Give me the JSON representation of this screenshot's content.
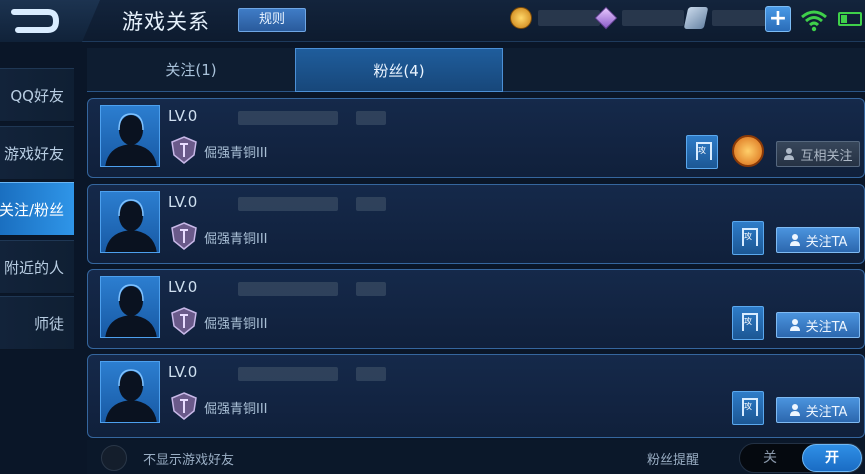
{
  "header": {
    "title": "游戏关系",
    "rules_label": "规则",
    "plus_label": "+"
  },
  "sidebar": {
    "items": [
      {
        "label": "QQ好友"
      },
      {
        "label": "游戏好友"
      },
      {
        "label": "关注/粉丝"
      },
      {
        "label": "附近的人"
      },
      {
        "label": "师徒"
      }
    ]
  },
  "tabs": [
    {
      "label": "关注(1)"
    },
    {
      "label": "粉丝(4)"
    }
  ],
  "rows": [
    {
      "level": "LV.0",
      "rank": "倔强青铜III",
      "tag_glyph": "攻",
      "action": "互相关注"
    },
    {
      "level": "LV.0",
      "rank": "倔强青铜III",
      "tag_glyph": "攻",
      "action": "关注TA"
    },
    {
      "level": "LV.0",
      "rank": "倔强青铜III",
      "tag_glyph": "攻",
      "action": "关注TA"
    },
    {
      "level": "LV.0",
      "rank": "倔强青铜III",
      "tag_glyph": "攻",
      "action": "关注TA"
    }
  ],
  "footer": {
    "hide_label": "不显示游戏好友",
    "fans_remind_label": "粉丝提醒",
    "toggle_off": "关",
    "toggle_on": "开"
  }
}
